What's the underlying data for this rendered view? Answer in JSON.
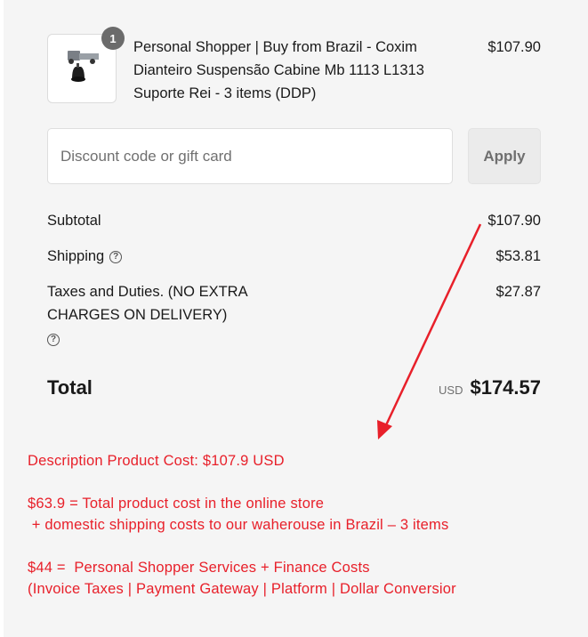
{
  "product": {
    "quantity": "1",
    "name": "Personal Shopper | Buy from Brazil - Coxim Dianteiro Suspensão Cabine Mb 1113 L1313 Suporte Rei - 3 items (DDP)",
    "price": "$107.90"
  },
  "discount": {
    "placeholder": "Discount code or gift card",
    "apply_label": "Apply"
  },
  "summary": {
    "subtotal_label": "Subtotal",
    "subtotal_value": "$107.90",
    "shipping_label": "Shipping",
    "shipping_value": "$53.81",
    "taxes_label": "Taxes and Duties. (NO EXTRA CHARGES ON DELIVERY)",
    "taxes_value": "$27.87",
    "help_glyph": "?",
    "total_label": "Total",
    "total_currency": "USD",
    "total_value": "$174.57"
  },
  "annotations": {
    "line1": "Description Product Cost: $107.9 USD",
    "line2": "$63.9 = Total product cost in the online store",
    "line3": " + domestic shipping costs to our waherouse in Brazil – 3 items",
    "line4": "$44 =  Personal Shopper Services + Finance Costs",
    "line5": "(Invoice Taxes | Payment Gateway | Platform | Dollar Conversior"
  },
  "colors": {
    "annotation": "#e8202a",
    "badge": "#6b6b6b",
    "background": "#f5f5f5"
  }
}
